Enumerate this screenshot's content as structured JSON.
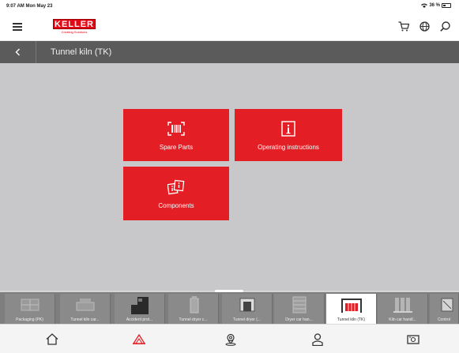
{
  "status": {
    "time": "9:07 AM  Mon May 23",
    "battery": "36 %"
  },
  "header": {
    "logo_text": "KELLER",
    "logo_tagline": "Creating Solutions"
  },
  "nav": {
    "title": "Tunnel kiln (TK)"
  },
  "tiles": {
    "spare_parts": "Spare Parts",
    "operating_instructions": "Operating instructions",
    "components": "Components"
  },
  "carousel": [
    "Packaging (PK)",
    "Tunnel kiln car...",
    "Accident prot...",
    "Tunnel dryer c...",
    "Tunnel dryer (...",
    "Dryer car han...",
    "Tunnel kiln (TK)",
    "Kiln car handl...",
    "Control"
  ],
  "colors": {
    "brand_red": "#e31e24",
    "nav_gray": "#5b5b5b",
    "content_gray": "#c8c8ca"
  },
  "icons": {
    "tabs": [
      "home-icon",
      "plant-icon",
      "location-icon",
      "user-icon",
      "scan-icon"
    ]
  }
}
